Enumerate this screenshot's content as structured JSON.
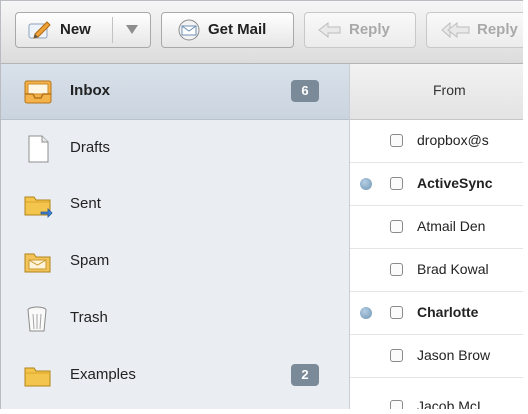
{
  "toolbar": {
    "new_label": "New",
    "getmail_label": "Get Mail",
    "reply_label": "Reply",
    "replyall_label": "Reply",
    "icons": {
      "new": "compose-pencil-icon",
      "new_menu": "dropdown-arrow-icon",
      "getmail": "get-mail-icon",
      "reply": "reply-arrow-icon",
      "replyall": "reply-all-arrow-icon"
    }
  },
  "sidebar": {
    "items": [
      {
        "label": "Inbox",
        "badge": "6",
        "icon": "inbox-icon",
        "selected": true
      },
      {
        "label": "Drafts",
        "badge": "",
        "icon": "document-icon"
      },
      {
        "label": "Sent",
        "badge": "",
        "icon": "sent-folder-icon"
      },
      {
        "label": "Spam",
        "badge": "",
        "icon": "spam-folder-icon"
      },
      {
        "label": "Trash",
        "badge": "",
        "icon": "trash-can-icon"
      },
      {
        "label": "Examples",
        "badge": "2",
        "icon": "folder-icon"
      }
    ]
  },
  "message_list": {
    "header": "From",
    "rows": [
      {
        "from": "dropbox@s",
        "unread": false
      },
      {
        "from": "ActiveSync",
        "unread": true
      },
      {
        "from": "Atmail Den",
        "unread": false
      },
      {
        "from": "Brad Kowal",
        "unread": false
      },
      {
        "from": "Charlotte",
        "unread": true
      },
      {
        "from": "Jason Brow",
        "unread": false
      },
      {
        "from": "Jacob McI",
        "unread": false
      }
    ]
  },
  "colors": {
    "sidebar_bg": "#eaeef3",
    "selected_bg": "#cfd8e2",
    "badge_bg": "#7b8a99",
    "unread_dot": "#7f9fbb"
  }
}
